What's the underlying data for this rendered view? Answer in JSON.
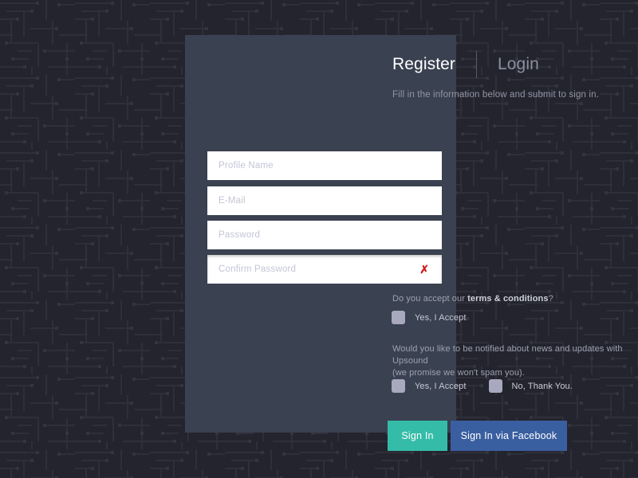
{
  "theme": {
    "page_background": "#24242E",
    "card_background": "#3A4150",
    "accent_teal": "#35BCA8",
    "facebook_blue": "#3A5FA0",
    "error_red": "#CC1F1F",
    "checkbox_fill": "#A8A8BE",
    "input_background": "#FFFFFF"
  },
  "tabs": {
    "register_label": "Register",
    "login_label": "Login"
  },
  "intro": {
    "text": "Fill in the information below and submit to sign in."
  },
  "form": {
    "fields": [
      {
        "name": "profile-name",
        "placeholder": "Profile Name",
        "value": "",
        "error": false
      },
      {
        "name": "email",
        "placeholder": "E-Mail",
        "value": "",
        "error": false
      },
      {
        "name": "password",
        "placeholder": "Password",
        "value": "",
        "error": false
      },
      {
        "name": "confirm-password",
        "placeholder": "Confirm Password",
        "value": "",
        "error": true,
        "error_icon": "error-x-icon",
        "error_glyph": "✗"
      }
    ]
  },
  "terms": {
    "question_prefix": "Do you accept our ",
    "question_link": "terms & conditions",
    "question_suffix": "?",
    "accept_label": "Yes, I Accept"
  },
  "newsletter": {
    "question_line1": "Would you like to be notified about news and updates with Upsound",
    "question_line2": "(we promise we won't spam you).",
    "accept_label": "Yes, I Accept",
    "decline_label": "No, Thank You."
  },
  "actions": {
    "signin_label": "Sign In",
    "facebook_label": "Sign In via Facebook"
  }
}
